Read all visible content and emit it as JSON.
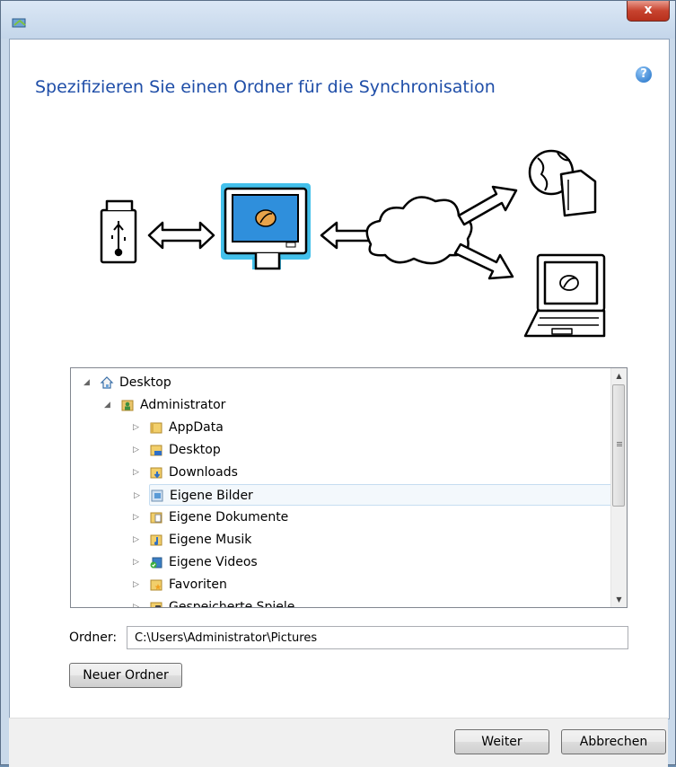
{
  "window": {
    "close_label": "x",
    "help_label": "?"
  },
  "page_title": "Spezifizieren Sie einen Ordner für die Synchronisation",
  "tree": {
    "items": [
      {
        "label": "Desktop",
        "icon": "home-icon",
        "level": 0,
        "expander": "◢"
      },
      {
        "label": "Administrator",
        "icon": "user-folder-icon",
        "level": 1,
        "expander": "◢"
      },
      {
        "label": "AppData",
        "icon": "folder-icon",
        "level": 2,
        "expander": "▷"
      },
      {
        "label": "Desktop",
        "icon": "desktop-folder-icon",
        "level": 2,
        "expander": "▷"
      },
      {
        "label": "Downloads",
        "icon": "downloads-folder-icon",
        "level": 2,
        "expander": "▷"
      },
      {
        "label": "Eigene Bilder",
        "icon": "pictures-folder-icon",
        "level": 2,
        "expander": "▷",
        "selected": true
      },
      {
        "label": "Eigene Dokumente",
        "icon": "documents-folder-icon",
        "level": 2,
        "expander": "▷"
      },
      {
        "label": "Eigene Musik",
        "icon": "music-folder-icon",
        "level": 2,
        "expander": "▷"
      },
      {
        "label": "Eigene Videos",
        "icon": "videos-folder-icon",
        "level": 2,
        "expander": "▷"
      },
      {
        "label": "Favoriten",
        "icon": "favorites-folder-icon",
        "level": 2,
        "expander": "▷"
      },
      {
        "label": "Gespeicherte Spiele",
        "icon": "saved-games-folder-icon",
        "level": 2,
        "expander": "▷"
      }
    ]
  },
  "folder": {
    "label": "Ordner:",
    "value": "C:\\Users\\Administrator\\Pictures"
  },
  "buttons": {
    "new_folder": "Neuer Ordner",
    "next": "Weiter",
    "cancel": "Abbrechen"
  },
  "colors": {
    "title_blue": "#1f4ea8",
    "accent_cyan": "#22b5e8",
    "screen_blue": "#2f8fdc"
  }
}
